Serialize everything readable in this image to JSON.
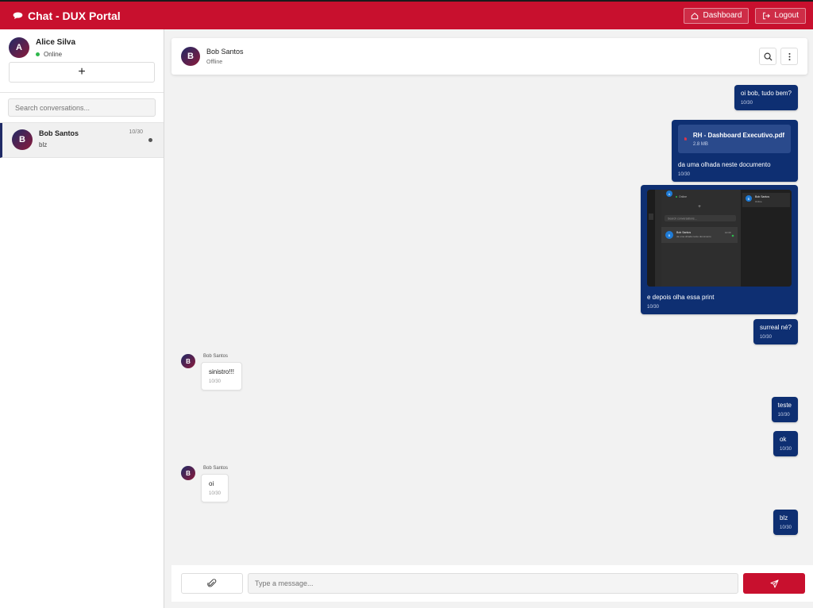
{
  "app": {
    "title": "Chat - DUX Portal",
    "icon": "chat-bubble-icon",
    "accent": "#c8102e",
    "bubble_color": "#0e2f72"
  },
  "topbar": {
    "dashboard_label": "Dashboard",
    "logout_label": "Logout"
  },
  "me": {
    "initial": "A",
    "name": "Alice Silva",
    "status": "Online"
  },
  "sidebar": {
    "new_chat_label": "+",
    "search_placeholder": "Search conversations...",
    "conversations": [
      {
        "initial": "B",
        "name": "Bob Santos",
        "time": "10/30",
        "preview": "blz"
      }
    ]
  },
  "chat": {
    "contact_initial": "B",
    "contact_name": "Bob Santos",
    "contact_status": "Offline",
    "messages": [
      {
        "dir": "out",
        "text": "oi bob, tudo bem?",
        "time": "10/30"
      },
      {
        "dir": "out",
        "file_name": "RH - Dashboard Executivo.pdf",
        "file_size": "2.8 MB",
        "text": "da uma olhada neste documento",
        "time": "10/30"
      },
      {
        "dir": "out",
        "image": "screenshot",
        "text": "e depois olha essa print",
        "time": "10/30",
        "image_content": {
          "me_status": "Online",
          "search": "Search conversations...",
          "conv_name": "Bob Santos",
          "conv_time": "10:30",
          "conv_preview": "da uma olhada neste documento",
          "header_name": "Bob Santos",
          "header_status": "Online"
        }
      },
      {
        "dir": "out",
        "text": "surreal né?",
        "time": "10/30"
      },
      {
        "dir": "in",
        "sender": "Bob Santos",
        "initial": "B",
        "text": "sinistro!!!",
        "time": "10/30"
      },
      {
        "dir": "out",
        "text": "teste",
        "time": "10/30"
      },
      {
        "dir": "out",
        "text": "ok",
        "time": "10/30"
      },
      {
        "dir": "in",
        "sender": "Bob Santos",
        "initial": "B",
        "text": "oi",
        "time": "10/30"
      },
      {
        "dir": "out",
        "text": "blz",
        "time": "10/30"
      }
    ]
  },
  "composer": {
    "placeholder": "Type a message..."
  }
}
